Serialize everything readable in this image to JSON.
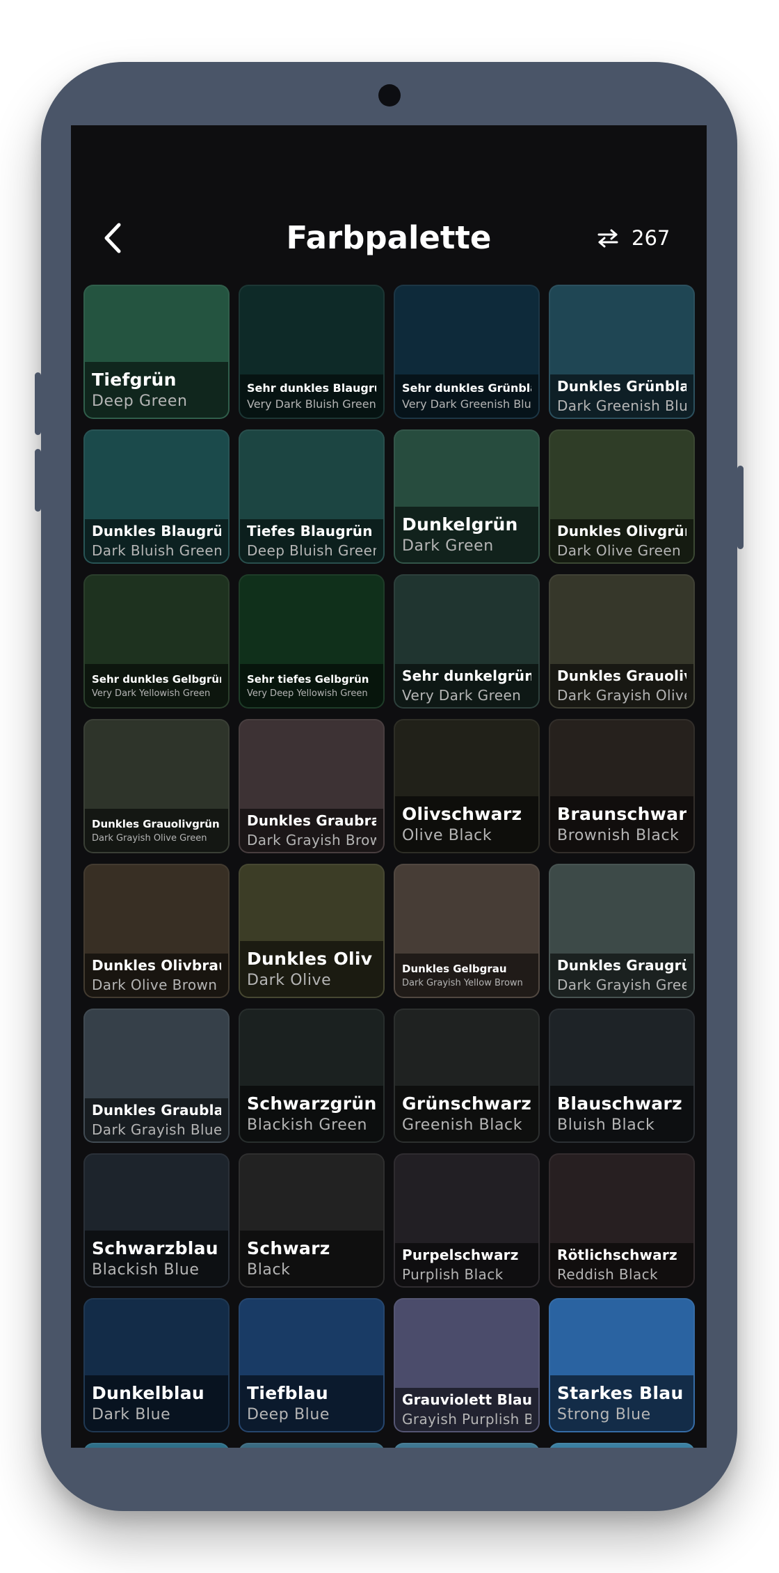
{
  "header": {
    "title": "Farbpalette",
    "count": "267",
    "back_icon": "chevron-left-icon",
    "swap_icon": "swap-arrows-icon"
  },
  "colors": [
    {
      "de": "Tiefgrün",
      "en": "Deep Green",
      "hex": "#245440",
      "size": "l"
    },
    {
      "de": "Sehr dunkles Blaugrün",
      "en": "Very Dark Bluish Green",
      "hex": "#0e2a28",
      "size": "s"
    },
    {
      "de": "Sehr dunkles Grünblau",
      "en": "Very Dark Greenish Blue",
      "hex": "#0e2a3a",
      "size": "s"
    },
    {
      "de": "Dunkles Grünblau",
      "en": "Dark Greenish Blue",
      "hex": "#1f4654",
      "size": "m"
    },
    {
      "de": "Dunkles Blaugrün",
      "en": "Dark Bluish Green",
      "hex": "#1b4a4b",
      "size": "m"
    },
    {
      "de": "Tiefes Blaugrün",
      "en": "Deep Bluish Green",
      "hex": "#1c4542",
      "size": "m"
    },
    {
      "de": "Dunkelgrün",
      "en": "Dark Green",
      "hex": "#274c3e",
      "size": "l"
    },
    {
      "de": "Dunkles Olivgrün",
      "en": "Dark Olive Green",
      "hex": "#2f3d27",
      "size": "m"
    },
    {
      "de": "Sehr dunkles Gelbgrün",
      "en": "Very Dark Yellowish Green",
      "hex": "#1e321f",
      "size": "xs"
    },
    {
      "de": "Sehr tiefes Gelbgrün",
      "en": "Very Deep Yellowish Green",
      "hex": "#10301b",
      "size": "xs"
    },
    {
      "de": "Sehr dunkelgrün",
      "en": "Very Dark Green",
      "hex": "#203530",
      "size": "m"
    },
    {
      "de": "Dunkles Grauoliv",
      "en": "Dark Grayish Olive",
      "hex": "#36372a",
      "size": "m"
    },
    {
      "de": "Dunkles Grauolivgrün",
      "en": "Dark Grayish Olive Green",
      "hex": "#2e342a",
      "size": "xs"
    },
    {
      "de": "Dunkles Graubraun",
      "en": "Dark Grayish Brown",
      "hex": "#3d3234",
      "size": "m"
    },
    {
      "de": "Olivschwarz",
      "en": "Olive Black",
      "hex": "#212119",
      "size": "l"
    },
    {
      "de": "Braunschwarz",
      "en": "Brownish Black",
      "hex": "#26211d",
      "size": "l"
    },
    {
      "de": "Dunkles Olivbraun",
      "en": "Dark Olive Brown",
      "hex": "#382f24",
      "size": "m"
    },
    {
      "de": "Dunkles Oliv",
      "en": "Dark Olive",
      "hex": "#3c3d26",
      "size": "l"
    },
    {
      "de": "Dunkles Gelbgrau",
      "en": "Dark Grayish Yellow Brown",
      "hex": "#473d36",
      "size": "xs"
    },
    {
      "de": "Dunkles Graugrün",
      "en": "Dark Grayish Green",
      "hex": "#3d4a48",
      "size": "m"
    },
    {
      "de": "Dunkles Graublau",
      "en": "Dark Grayish Blue",
      "hex": "#364049",
      "size": "m"
    },
    {
      "de": "Schwarzgrün",
      "en": "Blackish Green",
      "hex": "#1b2120",
      "size": "l"
    },
    {
      "de": "Grünschwarz",
      "en": "Greenish Black",
      "hex": "#1f2221",
      "size": "l"
    },
    {
      "de": "Blauschwarz",
      "en": "Bluish Black",
      "hex": "#1e2327",
      "size": "l"
    },
    {
      "de": "Schwarzblau",
      "en": "Blackish Blue",
      "hex": "#1d242c",
      "size": "l"
    },
    {
      "de": "Schwarz",
      "en": "Black",
      "hex": "#222222",
      "size": "l"
    },
    {
      "de": "Purpelschwarz",
      "en": "Purplish Black",
      "hex": "#221f24",
      "size": "m"
    },
    {
      "de": "Rötlichschwarz",
      "en": "Reddish Black",
      "hex": "#271f21",
      "size": "m"
    },
    {
      "de": "Dunkelblau",
      "en": "Dark Blue",
      "hex": "#132c48",
      "size": "l"
    },
    {
      "de": "Tiefblau",
      "en": "Deep Blue",
      "hex": "#193b65",
      "size": "l"
    },
    {
      "de": "Grauviolett Blau",
      "en": "Grayish Purplish Blue",
      "hex": "#4b4c6b",
      "size": "m"
    },
    {
      "de": "Starkes Blau",
      "en": "Strong Blue",
      "hex": "#2a63a1",
      "size": "l"
    }
  ],
  "peek_colors": [
    "#2e6f88",
    "#3a6a80",
    "#3f7791",
    "#3b7fa1"
  ]
}
